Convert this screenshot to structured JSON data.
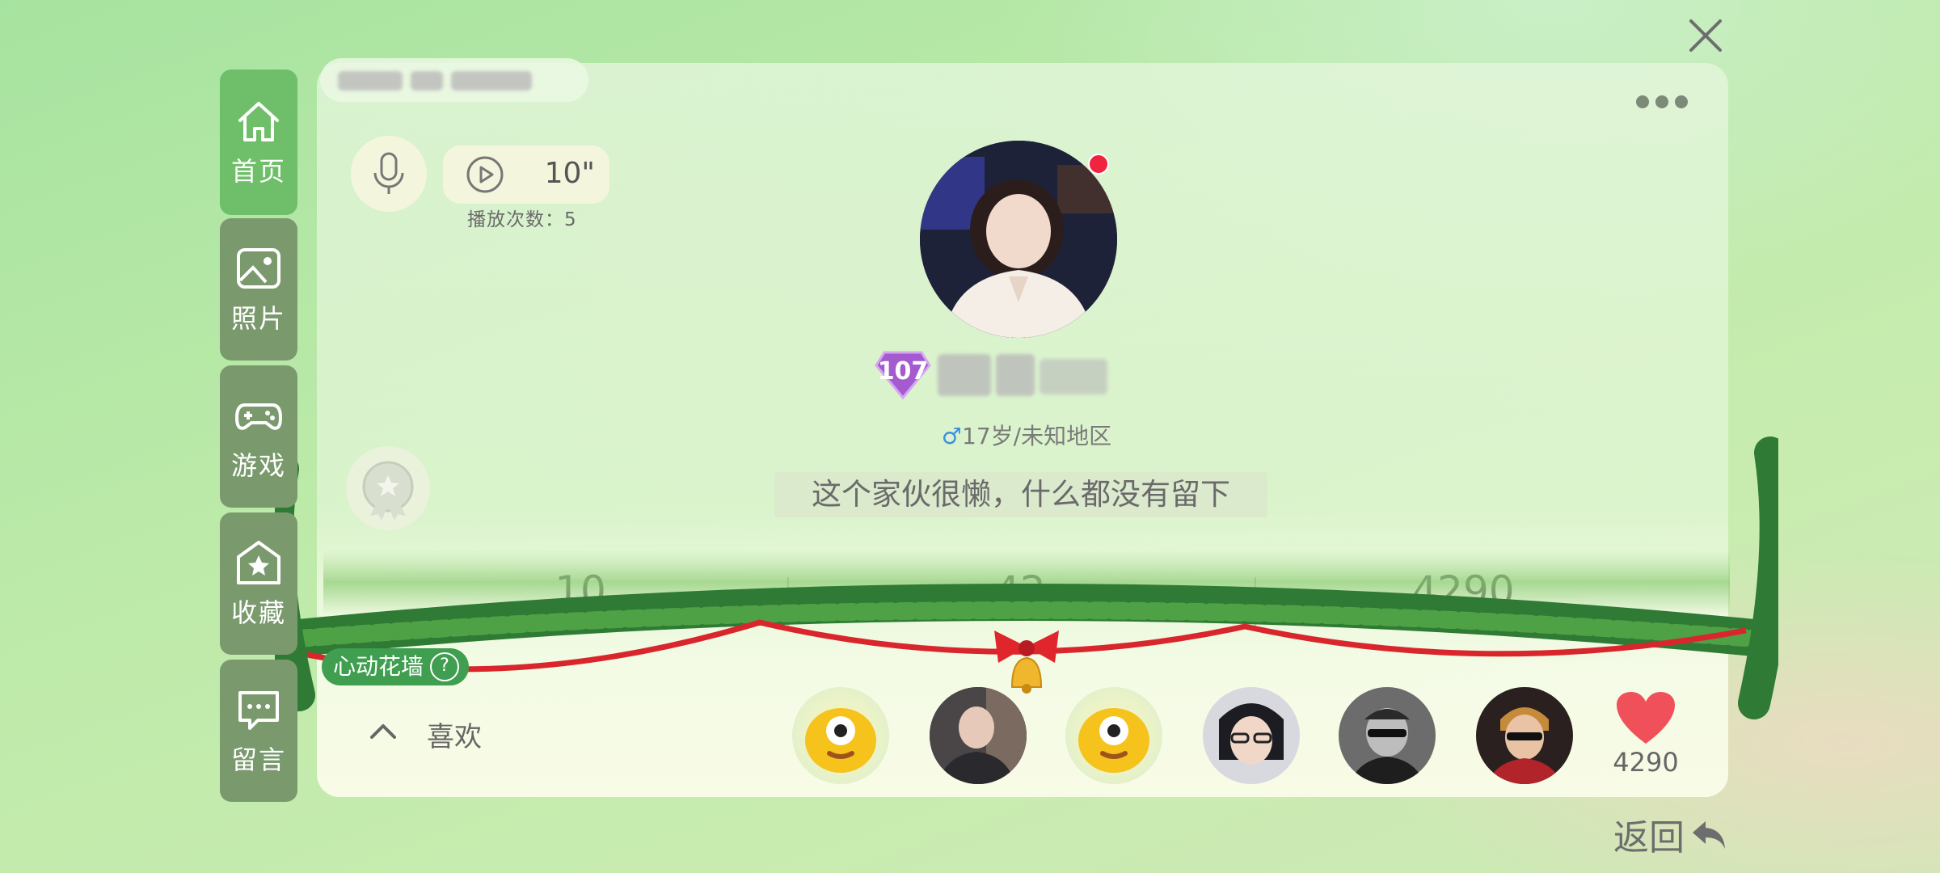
{
  "nav": {
    "items": [
      {
        "label": "首页",
        "icon": "home-icon",
        "active": true
      },
      {
        "label": "照片",
        "icon": "photo-icon",
        "active": false
      },
      {
        "label": "游戏",
        "icon": "gamepad-icon",
        "active": false
      },
      {
        "label": "收藏",
        "icon": "star-house-icon",
        "active": false
      },
      {
        "label": "留言",
        "icon": "message-icon",
        "active": false
      }
    ]
  },
  "voice": {
    "duration": "10\"",
    "play_count": "播放次数：5"
  },
  "profile": {
    "level": "107",
    "info_age_region": "17岁/未知地区",
    "gender_symbol": "♂",
    "signature": "这个家伙很懒，什么都没有留下"
  },
  "stats": {
    "values": [
      "10",
      "42",
      "4290"
    ]
  },
  "flower_wall": {
    "label": "心动花墙",
    "help": "?"
  },
  "likes": {
    "label": "喜欢",
    "count": "4290"
  },
  "footer": {
    "back_label": "返回"
  },
  "colors": {
    "nav_active": "#6fbf6a",
    "nav_inactive": "#7a9a6d",
    "online_dot": "#f0243e",
    "heart": "#f0505a",
    "level_badge": "#a45bd0"
  }
}
